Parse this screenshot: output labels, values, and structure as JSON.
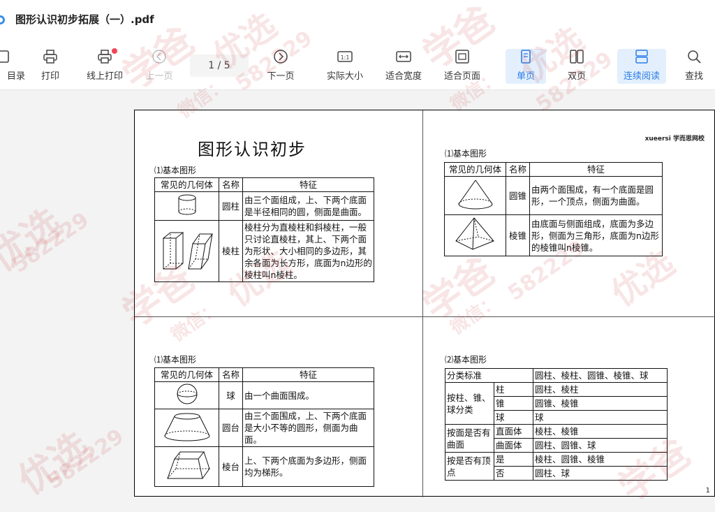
{
  "window": {
    "title": "图形认识初步拓展（一）.pdf"
  },
  "toolbar": {
    "items": [
      {
        "label": "目录",
        "icon": "toc-icon"
      },
      {
        "label": "打印",
        "icon": "printer-icon"
      },
      {
        "label": "线上打印",
        "icon": "online-print-icon"
      },
      {
        "label": "上一页",
        "icon": "previous-page-icon"
      },
      {
        "label": "下一页",
        "icon": "next-page-icon"
      },
      {
        "label": "实际大小",
        "icon": "actual-size-icon"
      },
      {
        "label": "适合宽度",
        "icon": "fit-width-icon"
      },
      {
        "label": "适合页面",
        "icon": "fit-page-icon"
      },
      {
        "label": "单页",
        "icon": "single-page-icon"
      },
      {
        "label": "双页",
        "icon": "double-page-icon"
      },
      {
        "label": "连续阅读",
        "icon": "continuous-read-icon"
      },
      {
        "label": "查找",
        "icon": "search-icon"
      }
    ],
    "page_indicator": "1 / 5",
    "active": [
      "单页",
      "连续阅读"
    ]
  },
  "doc": {
    "title": "图形认识初步",
    "brand": "xueersi 学而思网校",
    "page_number": "1",
    "panel1": {
      "section": "⑴基本图形",
      "headers": [
        "常见的几何体",
        "名称",
        "特征"
      ],
      "rows": [
        {
          "name": "圆柱",
          "feature": "由三个面组成，上、下两个底面是半径相同的圆，侧面是曲面。"
        },
        {
          "name": "棱柱",
          "feature": "棱柱分为直棱柱和斜棱柱，一般只讨论直棱柱，其上、下两个面为形状、大小相同的多边形，其余各面为长方形，底面为n边形的棱柱叫n棱柱。"
        }
      ]
    },
    "panel2": {
      "section": "⑴基本图形",
      "headers": [
        "常见的几何体",
        "名称",
        "特征"
      ],
      "rows": [
        {
          "name": "圆锥",
          "feature": "由两个面围成，有一个底面是圆形，一个顶点，侧面为曲面。"
        },
        {
          "name": "棱锥",
          "feature": "由底面与侧面组成，底面为多边形，侧面为三角形，底面为n边形的棱锥叫n棱锥。"
        }
      ]
    },
    "panel3": {
      "section": "⑴基本图形",
      "headers": [
        "常见的几何体",
        "名称",
        "特征"
      ],
      "rows": [
        {
          "name": "球",
          "feature": "由一个曲面围成。"
        },
        {
          "name": "圆台",
          "feature": "由三个面围成，上、下两个底面是大小不等的圆形，侧面为曲面。"
        },
        {
          "name": "棱台",
          "feature": "上、下两个底面为多边形，侧面均为梯形。"
        }
      ]
    },
    "panel4": {
      "section": "⑵基本图形",
      "header": [
        "分类标准",
        "圆柱、棱柱、圆锥、棱锥、球"
      ],
      "groups": [
        {
          "criterion": "按柱、锥、球分类",
          "items": [
            {
              "k": "柱",
              "v": "圆柱、棱柱"
            },
            {
              "k": "锥",
              "v": "圆锥、棱锥"
            },
            {
              "k": "球",
              "v": "球"
            }
          ]
        },
        {
          "criterion": "按面是否有曲面",
          "items": [
            {
              "k": "直面体",
              "v": "棱柱、棱锥"
            },
            {
              "k": "曲面体",
              "v": "圆柱、圆锥、球"
            }
          ]
        },
        {
          "criterion": "按是否有顶点",
          "items": [
            {
              "k": "是",
              "v": "棱柱、圆锥、棱锥"
            },
            {
              "k": "否",
              "v": "圆柱、球"
            }
          ]
        }
      ]
    }
  },
  "watermark": [
    "学爸",
    "优选",
    "微信：",
    "582229"
  ]
}
